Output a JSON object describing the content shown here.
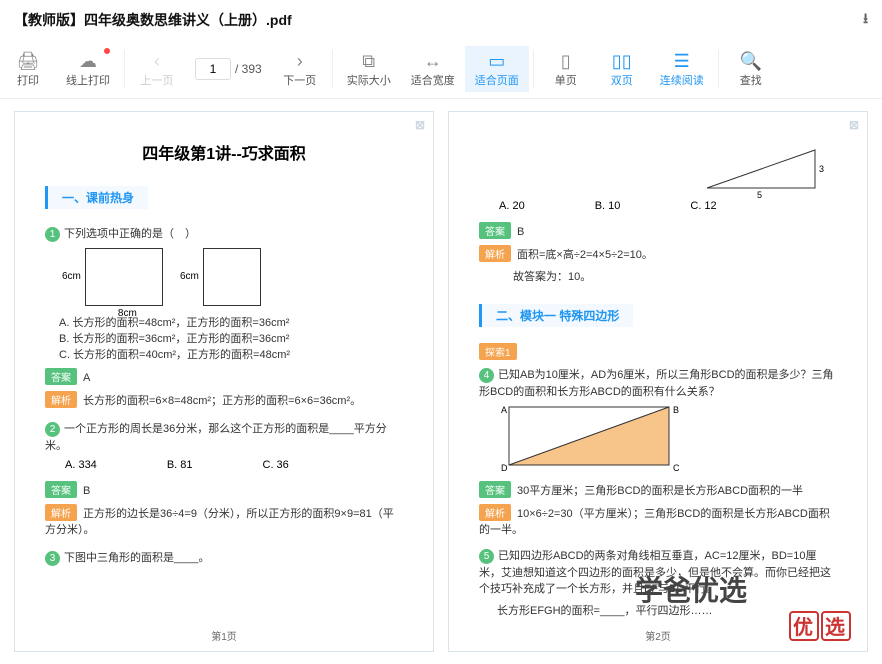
{
  "title": "【教师版】四年级奥数思维讲义（上册）.pdf",
  "toolbar": {
    "print": "打印",
    "onlinePrint": "线上打印",
    "prev": "上一页",
    "curPage": "1",
    "totalPages": "/ 393",
    "next": "下一页",
    "actualSize": "实际大小",
    "fitWidth": "适合宽度",
    "fitPage": "适合页面",
    "single": "单页",
    "double": "双页",
    "continuous": "连续阅读",
    "find": "查找"
  },
  "page1": {
    "heading": "四年级第1讲--巧求面积",
    "sect": "一、课前热身",
    "q1": {
      "n": "1",
      "text": "下列选项中正确的是（　）",
      "r1": {
        "l": "6cm",
        "b": "8cm"
      },
      "r2": {
        "l": "6cm"
      },
      "optA": "A. 长方形的面积=48cm²，正方形的面积=36cm²",
      "optB": "B. 长方形的面积=36cm²，正方形的面积=36cm²",
      "optC": "C. 长方形的面积=40cm²，正方形的面积=48cm²",
      "ans": "A",
      "ansLbl": "答案",
      "expLbl": "解析",
      "exp": "长方形的面积=6×8=48cm²；正方形的面积=6×6=36cm²。"
    },
    "q2": {
      "n": "2",
      "text": "一个正方形的周长是36分米，那么这个正方形的面积是____平方分米。",
      "optA": "A. 334",
      "optB": "B. 81",
      "optC": "C. 36",
      "ans": "B",
      "ansLbl": "答案",
      "expLbl": "解析",
      "exp": "正方形的边长是36÷4=9（分米），所以正方形的面积9×9=81（平方分米）。"
    },
    "q3": {
      "n": "3",
      "text": "下图中三角形的面积是____。"
    },
    "footer": "第1页"
  },
  "page2": {
    "triLabels": {
      "a": "3",
      "b": "5"
    },
    "choices": {
      "a": "A. 20",
      "b": "B. 10",
      "c": "C. 12"
    },
    "ansLbl": "答案",
    "ans": "B",
    "expLbl": "解析",
    "exp": "面积=底×高÷2=4×5÷2=10。",
    "exp2": "故答案为：10。",
    "sect": "二、模块一 特殊四边形",
    "explore": "探索1",
    "q4": {
      "n": "4",
      "text": "已知AB为10厘米，AD为6厘米，所以三角形BCD的面积是多少？三角形BCD的面积和长方形ABCD的面积有什么关系？",
      "v": {
        "A": "A",
        "B": "B",
        "C": "C",
        "D": "D"
      },
      "ansLbl": "答案",
      "ans": "30平方厘米；三角形BCD的面积是长方形ABCD面积的一半",
      "expLbl": "解析",
      "exp": "10×6÷2=30（平方厘米）；三角形BCD的面积是长方形ABCD面积的一半。"
    },
    "q5": {
      "n": "5",
      "text": "已知四边形ABCD的两条对角线相互垂直，AC=12厘米，BD=10厘米，艾迪想知道这个四边形的面积是多少，但是他不会算。而你已经把这个技巧补充成了一个长方形，并且EF与BD平行。",
      "line2": "长方形EFGH的面积=____，平行四边形……"
    },
    "footer": "第2页",
    "brand": "学爸优选"
  }
}
